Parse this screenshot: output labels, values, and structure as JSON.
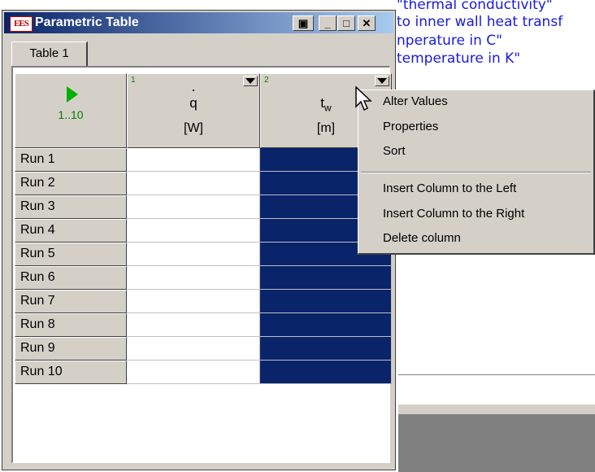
{
  "background": {
    "equation_lines": [
      "\"thermal conductivity\"",
      "to inner wall heat transf",
      "nperature in C\"",
      "temperature in K\""
    ]
  },
  "window": {
    "app_icon_text": "EES",
    "title": "Parametric Table",
    "min_glyph": "_",
    "max_glyph": "□",
    "close_glyph": "✕",
    "extra_glyph": "▣"
  },
  "tab": {
    "label": "Table 1"
  },
  "table": {
    "range_label": "1..10",
    "columns": [
      {
        "number": "1",
        "dot": ".",
        "var": "q",
        "sub": "",
        "unit": "[W]"
      },
      {
        "number": "2",
        "dot": "",
        "var": "t",
        "sub": "w",
        "unit": "[m]"
      }
    ],
    "rows": [
      "Run 1",
      "Run 2",
      "Run 3",
      "Run 4",
      "Run 5",
      "Run 6",
      "Run 7",
      "Run 8",
      "Run 9",
      "Run 10"
    ]
  },
  "context_menu": {
    "items": [
      "Alter Values",
      "Properties",
      "Sort",
      "Insert Column to the Left",
      "Insert Column to the Right",
      "Delete column"
    ]
  },
  "colors": {
    "title_start": "#0a246a",
    "title_end": "#a6caf0",
    "selection": "#0a246a",
    "equation_text": "#1a1adc",
    "run_indicator": "#00b000"
  }
}
